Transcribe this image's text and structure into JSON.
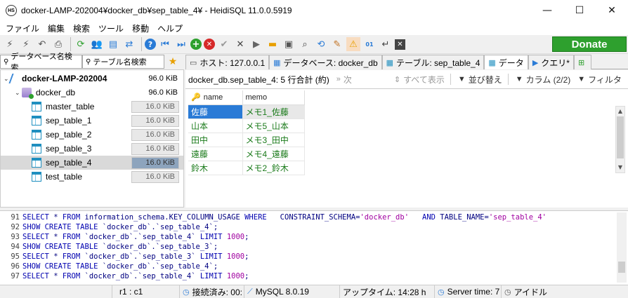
{
  "window": {
    "title": "docker-LAMP-202004¥docker_db¥sep_table_4¥ - HeidiSQL 11.0.0.5919",
    "app_icon_text": "HS",
    "minimize": "—",
    "maximize": "☐",
    "close": "✕"
  },
  "menu": [
    "ファイル",
    "編集",
    "検索",
    "ツール",
    "移動",
    "ヘルプ"
  ],
  "toolbar": {
    "donate_label": "Donate",
    "icons": [
      "connect-icon",
      "disconnect-icon",
      "undo-icon",
      "print-icon",
      "refresh-icon",
      "user-manager-icon",
      "export-icon",
      "transfer-icon",
      "help-icon",
      "first-icon",
      "last-icon",
      "add-icon",
      "delete-icon",
      "post-icon",
      "cancel-icon",
      "run-icon",
      "open-icon",
      "save-icon",
      "search-icon",
      "replace-icon",
      "format-icon",
      "warning-icon",
      "binary-icon",
      "wrap-icon",
      "close-tab-icon"
    ]
  },
  "left_panel": {
    "tab_db_filter": "データベース名検索",
    "tab_table_filter": "テーブル名検索",
    "tree": [
      {
        "label": "docker-LAMP-202004",
        "size": "96.0 KiB",
        "level": 0,
        "type": "server",
        "bold": true
      },
      {
        "label": "docker_db",
        "size": "96.0 KiB",
        "level": 1,
        "type": "database",
        "bold": false
      },
      {
        "label": "master_table",
        "size": "16.0 KiB",
        "level": 2,
        "type": "table"
      },
      {
        "label": "sep_table_1",
        "size": "16.0 KiB",
        "level": 2,
        "type": "table"
      },
      {
        "label": "sep_table_2",
        "size": "16.0 KiB",
        "level": 2,
        "type": "table"
      },
      {
        "label": "sep_table_3",
        "size": "16.0 KiB",
        "level": 2,
        "type": "table"
      },
      {
        "label": "sep_table_4",
        "size": "16.0 KiB",
        "level": 2,
        "type": "table",
        "selected": true
      },
      {
        "label": "test_table",
        "size": "16.0 KiB",
        "level": 2,
        "type": "table"
      }
    ]
  },
  "right_tabs": [
    {
      "label": "ホスト: 127.0.0.1",
      "icon": "host-icon"
    },
    {
      "label": "データベース: docker_db",
      "icon": "database-icon"
    },
    {
      "label": "テーブル: sep_table_4",
      "icon": "table-icon"
    },
    {
      "label": "データ",
      "icon": "data-icon",
      "active": true
    },
    {
      "label": "クエリ*",
      "icon": "query-icon"
    },
    {
      "label": "",
      "icon": "new-query-tab-icon"
    }
  ],
  "data_bar": {
    "summary": "docker_db.sep_table_4: 5 行合計 (約)",
    "next": "次",
    "show_all": "すべて表示",
    "sort": "並び替え",
    "columns": "カラム (2/2)",
    "filter": "フィルタ"
  },
  "grid": {
    "columns": [
      "name",
      "memo"
    ],
    "rows": [
      [
        "佐藤",
        "メモ1_佐藤"
      ],
      [
        "山本",
        "メモ5_山本"
      ],
      [
        "田中",
        "メモ3_田中"
      ],
      [
        "遠藤",
        "メモ4_遠藤"
      ],
      [
        "鈴木",
        "メモ2_鈴木"
      ]
    ]
  },
  "log": [
    {
      "n": "91",
      "parts": [
        [
          "kw",
          "SELECT"
        ],
        [
          "tx",
          " * "
        ],
        [
          "kw",
          "FROM"
        ],
        [
          "tx",
          " information_schema.KEY_COLUMN_USAGE "
        ],
        [
          "kw",
          "WHERE"
        ],
        [
          "tx",
          "   CONSTRAINT_SCHEMA="
        ],
        [
          "str",
          "'docker_db'"
        ],
        [
          "tx",
          "   "
        ],
        [
          "kw",
          "AND"
        ],
        [
          "tx",
          " TABLE_NAME="
        ],
        [
          "str",
          "'sep_table_4'"
        ]
      ]
    },
    {
      "n": "92",
      "parts": [
        [
          "kw",
          "SHOW CREATE TABLE"
        ],
        [
          "tx",
          " `docker_db`.`sep_table_4`;"
        ]
      ]
    },
    {
      "n": "93",
      "parts": [
        [
          "kw",
          "SELECT"
        ],
        [
          "tx",
          " * "
        ],
        [
          "kw",
          "FROM"
        ],
        [
          "tx",
          " `docker_db`.`sep_table_4` "
        ],
        [
          "kw",
          "LIMIT"
        ],
        [
          "tx",
          " "
        ],
        [
          "num",
          "1000"
        ],
        [
          "tx",
          ";"
        ]
      ]
    },
    {
      "n": "94",
      "parts": [
        [
          "kw",
          "SHOW CREATE TABLE"
        ],
        [
          "tx",
          " `docker_db`.`sep_table_3`;"
        ]
      ]
    },
    {
      "n": "95",
      "parts": [
        [
          "kw",
          "SELECT"
        ],
        [
          "tx",
          " * "
        ],
        [
          "kw",
          "FROM"
        ],
        [
          "tx",
          " `docker_db`.`sep_table_3` "
        ],
        [
          "kw",
          "LIMIT"
        ],
        [
          "tx",
          " "
        ],
        [
          "num",
          "1000"
        ],
        [
          "tx",
          ";"
        ]
      ]
    },
    {
      "n": "96",
      "parts": [
        [
          "kw",
          "SHOW CREATE TABLE"
        ],
        [
          "tx",
          " `docker_db`.`sep_table_4`;"
        ]
      ]
    },
    {
      "n": "97",
      "parts": [
        [
          "kw",
          "SELECT"
        ],
        [
          "tx",
          " * "
        ],
        [
          "kw",
          "FROM"
        ],
        [
          "tx",
          " `docker_db`.`sep_table_4` "
        ],
        [
          "kw",
          "LIMIT"
        ],
        [
          "tx",
          " "
        ],
        [
          "num",
          "1000"
        ],
        [
          "tx",
          ";"
        ]
      ]
    }
  ],
  "status": {
    "cursor": "r1 : c1",
    "connected": "接続済み: 00:",
    "server": "MySQL 8.0.19",
    "uptime": "アップタイム: 14:28 h",
    "server_time": "Server time: 7",
    "idle": "アイドル"
  }
}
